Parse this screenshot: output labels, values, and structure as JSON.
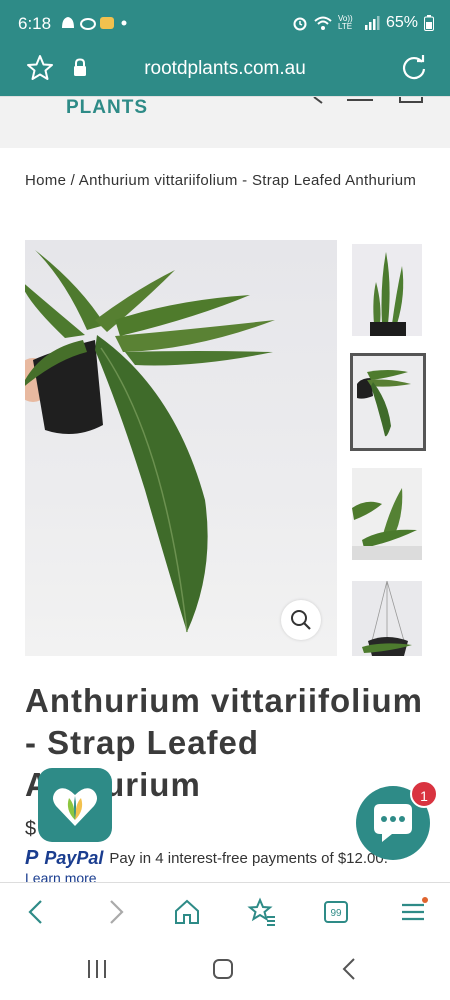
{
  "status_bar": {
    "time": "6:18",
    "network_label": "Vo)) LTE",
    "battery": "65%"
  },
  "url_bar": {
    "url": "rootdplants.com.au"
  },
  "site_header": {
    "logo_text": "PLANTS"
  },
  "breadcrumb": {
    "home": "Home",
    "separator": " / ",
    "current": "Anthurium vittariifolium - Strap Leafed Anthurium"
  },
  "product": {
    "title": "Anthurium vittariifolium - Strap Leafed Anthurium",
    "price_partial": "$",
    "paypal_brand": "PayPal",
    "paypal_text": "Pay in 4 interest-free payments of $12.00.",
    "learn_more": "Learn more"
  },
  "chat": {
    "badge_count": "1"
  },
  "browser_nav": {
    "tabs_count": "99"
  },
  "colors": {
    "brand_teal": "#2e8b87",
    "badge_red": "#d93340",
    "paypal_blue": "#1a3d8f"
  }
}
